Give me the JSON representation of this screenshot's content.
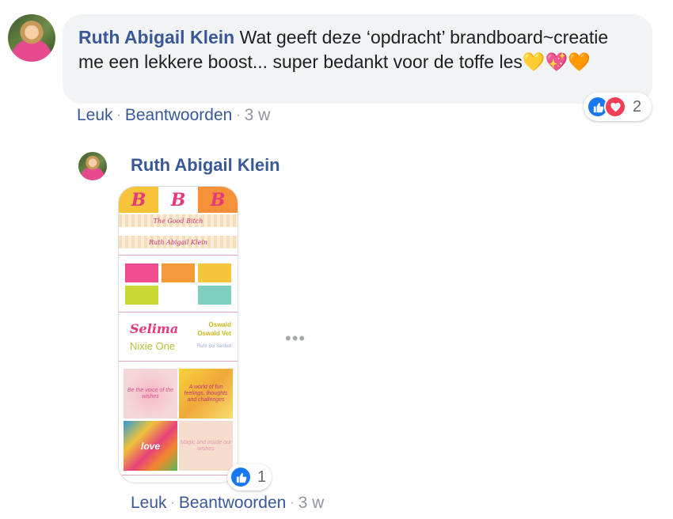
{
  "comment": {
    "author": "Ruth Abigail Klein",
    "text": "Wat geeft deze ‘opdracht’ brandboard~creatie me een lekkere boost... super bedankt voor de toffe les",
    "emojis": "💛💖🧡",
    "reactions": {
      "count": "2",
      "icons": [
        "like-icon",
        "love-icon"
      ],
      "colors": {
        "like": "#1877f2",
        "love": "#f33e58"
      }
    },
    "actions": {
      "like": "Leuk",
      "reply": "Beantwoorden",
      "time": "3 w"
    }
  },
  "reply": {
    "author": "Ruth Abigail Klein",
    "attachment": {
      "banner_title": "The Good Bitch",
      "banner_name": "Ruth Abigail Klein",
      "b_letters": [
        "B",
        "B",
        "B"
      ],
      "fonts": [
        "Selima",
        "Nixie One",
        "Oswald",
        "Oswald Vet",
        "Ruhl Sci Serifed"
      ],
      "tiles": [
        "Be the voice of the wishes",
        "A world of fun feelings, thoughts and challenges",
        "love",
        "Magic and inside our wishes"
      ]
    },
    "more_menu": "•••",
    "reactions": {
      "count": "1",
      "icon": "like-icon"
    },
    "actions": {
      "like": "Leuk",
      "reply": "Beantwoorden",
      "time": "3 w"
    }
  }
}
